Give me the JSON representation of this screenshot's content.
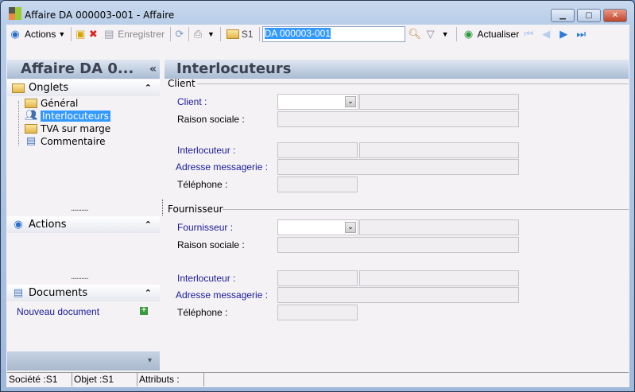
{
  "window": {
    "title": "Affaire DA 000003-001 -  Affaire",
    "minimize": "▁",
    "maximize": "▢",
    "close": "✕"
  },
  "toolbar": {
    "actions": "Actions",
    "save": "Enregistrer",
    "company": "S1",
    "search_value": "DA 000003-001",
    "refresh": "Actualiser"
  },
  "left": {
    "header": "Affaire DA 0...",
    "collapse": "«",
    "onglets": {
      "title": "Onglets",
      "items": [
        {
          "label": "Général"
        },
        {
          "label": "Interlocuteurs"
        },
        {
          "label": "TVA sur marge"
        },
        {
          "label": "Commentaire"
        }
      ]
    },
    "actions": {
      "title": "Actions"
    },
    "documents": {
      "title": "Documents",
      "new": "Nouveau document"
    },
    "splitter": "..........",
    "expand": "▾"
  },
  "main": {
    "header": "Interlocuteurs",
    "client": {
      "group": "Client",
      "client": "Client :",
      "raison": "Raison sociale :",
      "interlocuteur": "Interlocuteur :",
      "adresse": "Adresse messagerie :",
      "telephone": "Téléphone :"
    },
    "fournisseur": {
      "group": "Fournisseur",
      "fournisseur": "Fournisseur :",
      "raison": "Raison sociale :",
      "interlocuteur": "Interlocuteur :",
      "adresse": "Adresse messagerie :",
      "telephone": "Téléphone :"
    }
  },
  "status": {
    "societe": "Société :S1",
    "objet": "Objet :S1",
    "attributs": "Attributs :"
  }
}
